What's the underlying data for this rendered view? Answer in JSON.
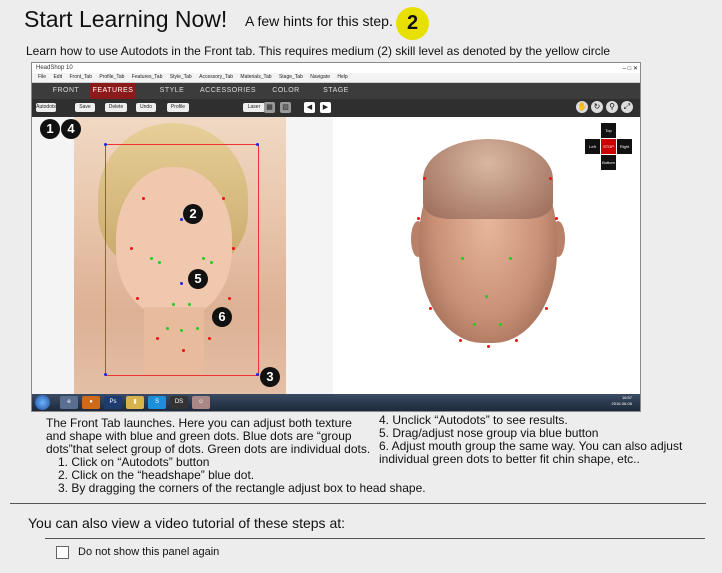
{
  "header": {
    "title": "Start Learning Now!",
    "subtitle": "A few hints for this step.",
    "skill_level": "2",
    "skill_color": "#e8e000",
    "intro": "Learn how to use Autodots in the Front tab. This requires medium (2) skill level as denoted by the yellow circle"
  },
  "app": {
    "window_title": "HeadShop 10",
    "menu": [
      "File",
      "Edit",
      "Front_Tab",
      "Profile_Tab",
      "Features_Tab",
      "Style_Tab",
      "Accessory_Tab",
      "Materials_Tab",
      "Stage_Tab",
      "Navigate",
      "Help"
    ],
    "tabs": [
      "FRONT",
      "FEATURES",
      "STYLE",
      "ACCESSORIES",
      "COLOR",
      "STAGE"
    ],
    "active_tab": "FEATURES",
    "toolbar": {
      "autodots": "Autodots",
      "save": "Save",
      "delete": "Delete",
      "undo": "Undo",
      "profile": "Profile",
      "laser": "Laser"
    },
    "nav_pad": {
      "top": "Top",
      "left": "Left",
      "stop": "STOP",
      "right": "Right",
      "bottom": "Bottom"
    },
    "taskbar_icons": [
      "ie-icon",
      "firefox-icon",
      "photoshop-icon",
      "folder-icon",
      "skype-icon",
      "daz-icon",
      "headshop-icon"
    ],
    "taskbar_labels": {
      "ps": "Ps",
      "ds": "DS"
    },
    "tray_time": "16:57",
    "tray_date": "2016-06-06",
    "markers": [
      "1",
      "4",
      "2",
      "5",
      "6",
      "3"
    ]
  },
  "instructions": {
    "left": [
      "The Front Tab launches. Here you can adjust both texture",
      "and shape with blue and green dots. Blue dots are “group",
      "dots”that select group of dots. Green dots are individual dots.",
      "1. Click on “Autodots” button",
      "2. Click on the “headshape” blue dot.",
      "3. By dragging the corners of the rectangle adjust box to head shape."
    ],
    "right": [
      "4. Unclick “Autodots” to see results.",
      "5. Drag/adjust nose group via blue button",
      "6. Adjust mouth group the same way. You can also adjust",
      "individual green dots to better fit chin shape, etc.."
    ]
  },
  "footer": {
    "video_text": "You can also view a video tutorial of these steps at:",
    "checkbox_label": "Do not show this panel again",
    "checkbox_checked": false
  }
}
